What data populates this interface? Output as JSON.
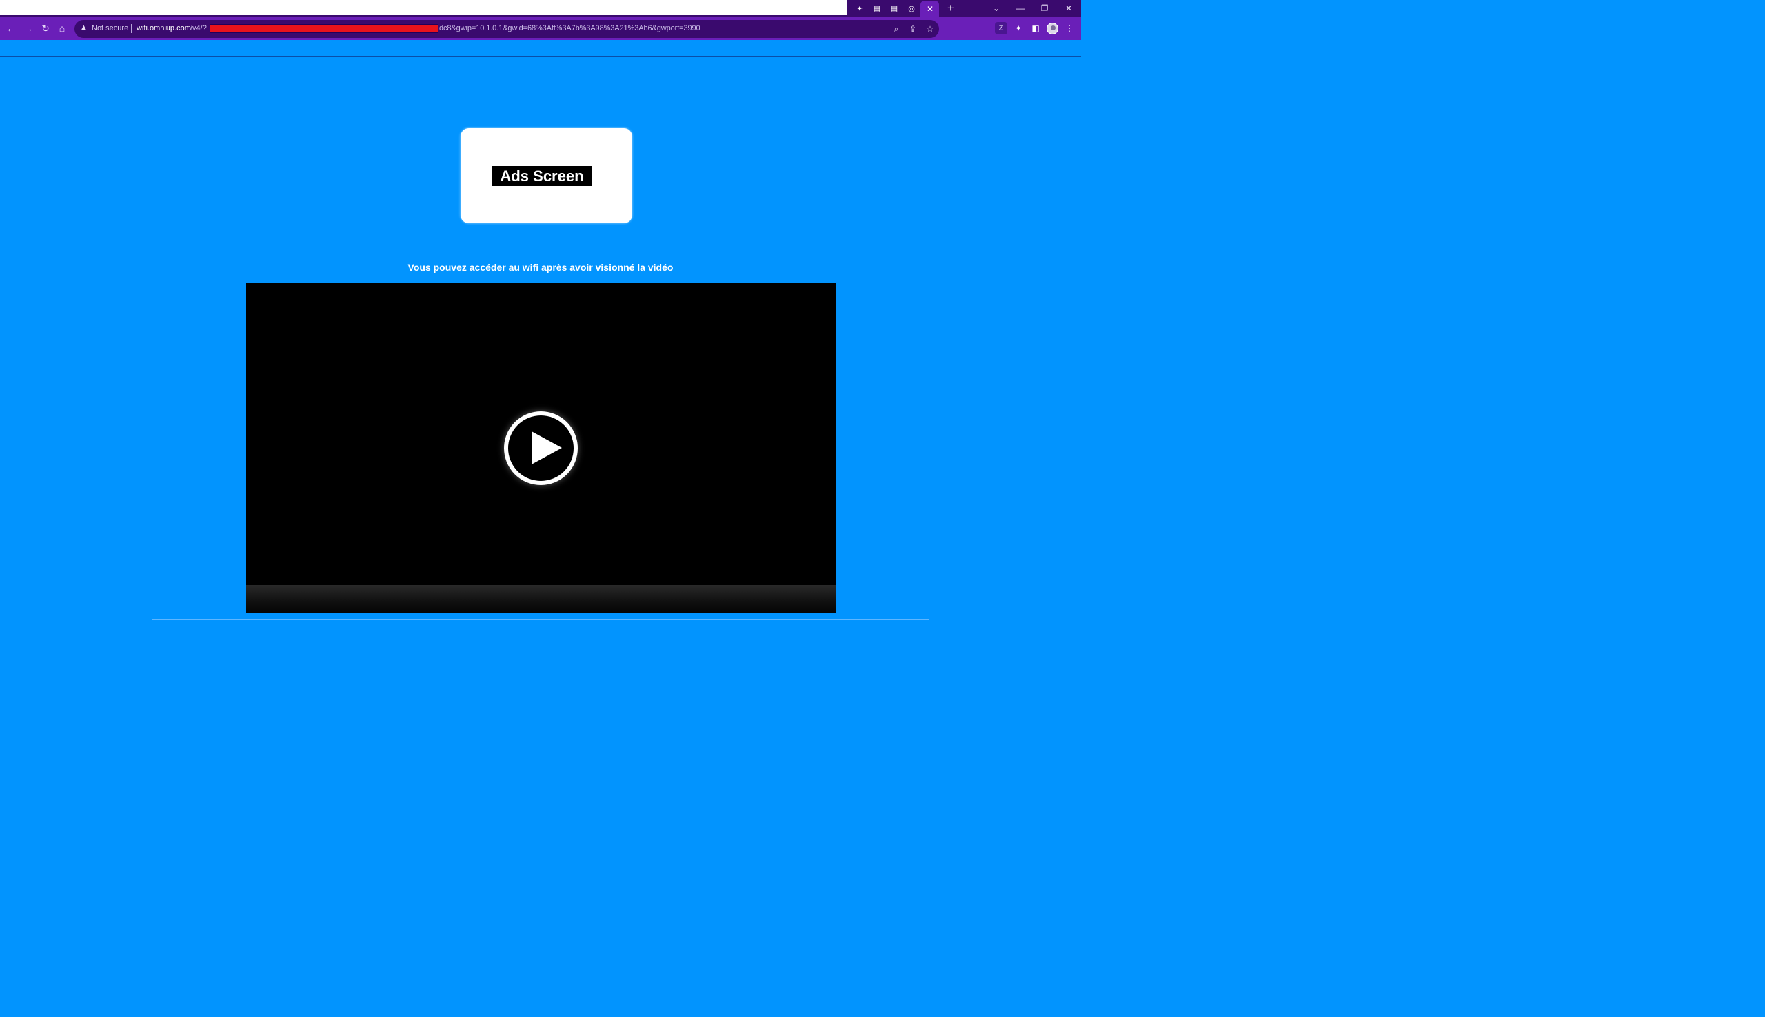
{
  "browser": {
    "tabs": [
      {
        "icon": "puzzle-icon"
      },
      {
        "icon": "newspaper-icon"
      },
      {
        "icon": "newspaper-icon"
      },
      {
        "icon": "chrome-icon",
        "active": true
      }
    ],
    "tab_close_glyph": "✕",
    "new_tab_glyph": "+",
    "window_controls": [
      "⌄",
      "—",
      "❐",
      "✕"
    ],
    "nav": {
      "back": "←",
      "forward": "→",
      "reload": "↻",
      "home": "⌂"
    },
    "security_label": "Not secure",
    "url_host": "wifi.omniup.com",
    "url_path": "/v4/?",
    "url_tail": "dc8&gwip=10.1.0.1&gwid=68%3Aff%3A7b%3A98%3A21%3Ab6&gwport=3990",
    "omnibox_icons": [
      "zoom-icon",
      "share-icon",
      "bookmark-star-icon"
    ],
    "toolbar_icons": [
      "extension-z-icon",
      "puzzle-icon",
      "side-panel-icon",
      "profile-avatar",
      "menu-icon"
    ]
  },
  "page": {
    "ad_label": "Ads Screen",
    "notice": "Vous pouvez accéder au wifi après avoir visionné la vidéo",
    "video": {
      "state": "paused"
    },
    "colors": {
      "background": "#0294fe",
      "toolbar": "#6a1fb8",
      "tabstrip": "#3a0a6e"
    }
  }
}
